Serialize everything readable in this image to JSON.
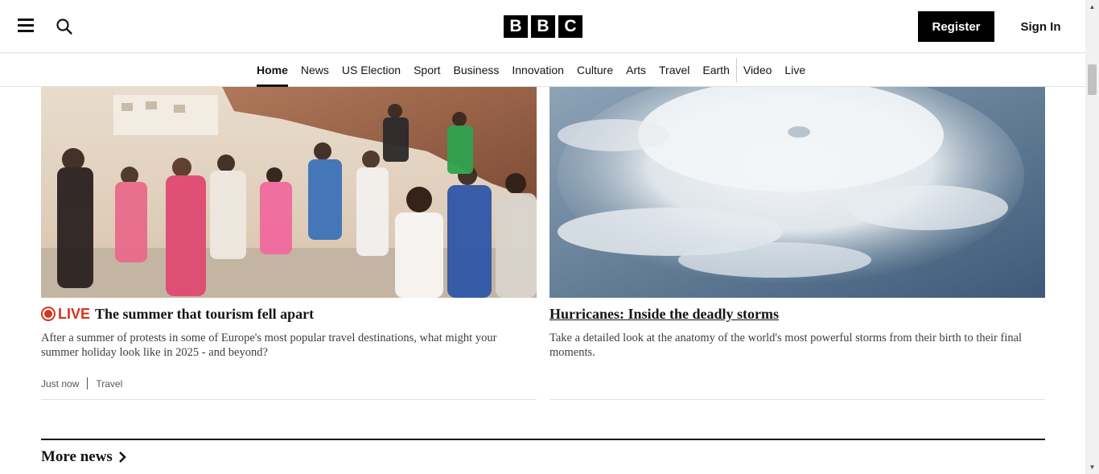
{
  "header": {
    "logo_letters": [
      "B",
      "B",
      "C"
    ],
    "register_label": "Register",
    "signin_label": "Sign In",
    "menu_icon": "hamburger-menu-icon",
    "search_icon": "search-icon"
  },
  "nav": {
    "items": [
      {
        "label": "Home",
        "active": true
      },
      {
        "label": "News"
      },
      {
        "label": "US Election"
      },
      {
        "label": "Sport"
      },
      {
        "label": "Business"
      },
      {
        "label": "Innovation"
      },
      {
        "label": "Culture"
      },
      {
        "label": "Arts"
      },
      {
        "label": "Travel"
      },
      {
        "label": "Earth"
      },
      {
        "label": "Video"
      },
      {
        "label": "Live"
      }
    ]
  },
  "cards": [
    {
      "live_label": "LIVE",
      "headline": "The summer that tourism fell apart",
      "summary": "After a summer of protests in some of Europe's most popular travel destinations, what might your summer holiday look like in 2025 - and beyond?",
      "timestamp": "Just now",
      "category": "Travel"
    },
    {
      "headline": "Hurricanes: Inside the deadly storms",
      "summary": "Take a detailed look at the anatomy of the world's most powerful storms from their birth to their final moments."
    }
  ],
  "more_news": {
    "label": "More news"
  },
  "colors": {
    "live_red": "#d4351c",
    "brand_black": "#000000"
  }
}
